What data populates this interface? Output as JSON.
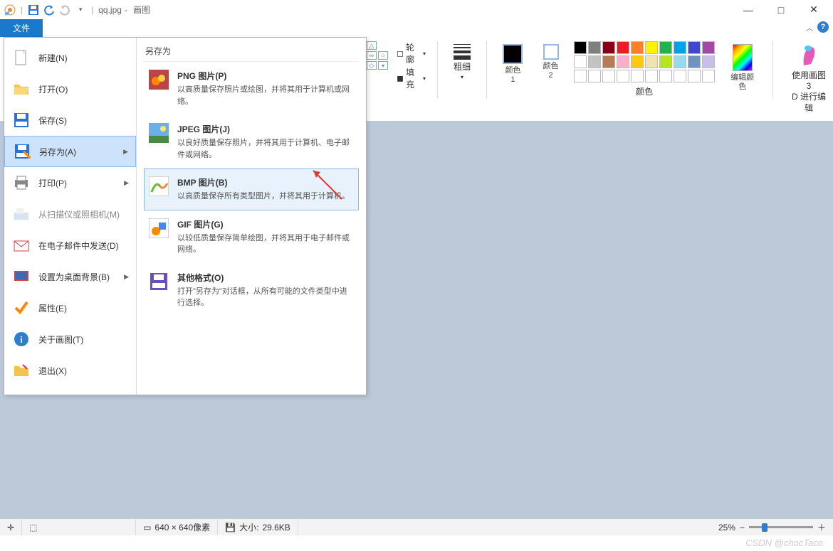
{
  "titlebar": {
    "filename": "qq.jpg",
    "app": "画图",
    "separator": "-"
  },
  "window": {
    "min": "—",
    "max": "□",
    "close": "✕"
  },
  "file_tab": "文件",
  "ribbon": {
    "outline": "轮廓",
    "fill": "填充",
    "stroke": "粗细",
    "color1": "颜色 1",
    "color2": "颜色 2",
    "edit_colors": "编辑颜色",
    "paint3d_l1": "使用画图 3",
    "paint3d_l2": "D 进行编辑",
    "group_colors": "颜色"
  },
  "palette_row1": [
    "#000",
    "#7f7f7f",
    "#880015",
    "#ed1c24",
    "#ff7f27",
    "#fff200",
    "#22b14c",
    "#00a2e8",
    "#3f48cc",
    "#a349a4"
  ],
  "palette_row2": [
    "#fff",
    "#c3c3c3",
    "#b97a57",
    "#ffaec9",
    "#ffc90e",
    "#efe4b0",
    "#b5e61d",
    "#99d9ea",
    "#7092be",
    "#c8bfe7"
  ],
  "file_menu": {
    "items": [
      {
        "label": "新建(N)",
        "icon": "doc"
      },
      {
        "label": "打开(O)",
        "icon": "folder"
      },
      {
        "label": "保存(S)",
        "icon": "save"
      },
      {
        "label": "另存为(A)",
        "icon": "saveas",
        "arrow": true,
        "selected": true
      },
      {
        "label": "打印(P)",
        "icon": "print",
        "arrow": true
      },
      {
        "label": "从扫描仪或照相机(M)",
        "icon": "scanner",
        "dim": true
      },
      {
        "label": "在电子邮件中发送(D)",
        "icon": "mail"
      },
      {
        "label": "设置为桌面背景(B)",
        "icon": "desktop",
        "arrow": true
      },
      {
        "label": "属性(E)",
        "icon": "check"
      },
      {
        "label": "关于画图(T)",
        "icon": "info"
      },
      {
        "label": "退出(X)",
        "icon": "exit"
      }
    ],
    "submenu_title": "另存为",
    "saveas": [
      {
        "title": "PNG 图片(P)",
        "desc": "以高质量保存照片或绘图，并将其用于计算机或网络。"
      },
      {
        "title": "JPEG 图片(J)",
        "desc": "以良好质量保存照片，并将其用于计算机、电子邮件或网络。"
      },
      {
        "title": "BMP 图片(B)",
        "desc": "以高质量保存所有类型图片，并将其用于计算机。",
        "hl": true
      },
      {
        "title": "GIF 图片(G)",
        "desc": "以较低质量保存简单绘图，并将其用于电子邮件或网络。"
      },
      {
        "title": "其他格式(O)",
        "desc": "打开\"另存为\"对话框，从所有可能的文件类型中进行选择。"
      }
    ]
  },
  "status": {
    "dim": "640 × 640像素",
    "size_lbl": "大小:",
    "size": "29.6KB",
    "zoom": "25%"
  },
  "watermark": "CSDN @chocTaco"
}
